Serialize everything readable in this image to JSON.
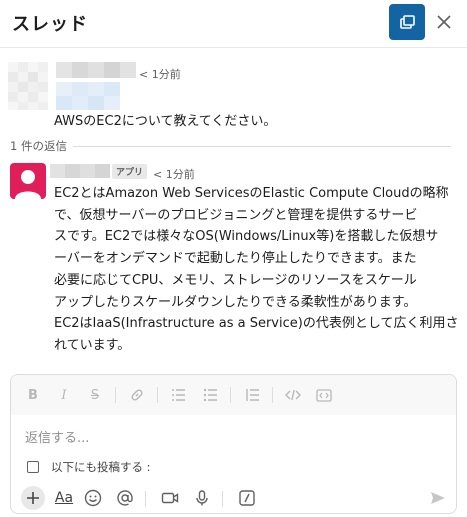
{
  "header": {
    "title": "スレッド"
  },
  "parent_message": {
    "time": "< 1分前",
    "text": "AWSのEC2について教えてください。"
  },
  "replies": {
    "count_label": "1 件の返信"
  },
  "reply": {
    "badge": "アプリ",
    "time": "< 1分前",
    "text": "EC2とはAmazon Web ServicesのElastic Compute Cloudの略称\nで、仮想サーバーのプロビジョニングと管理を提供するサービ\nスです。EC2では様々なOS(Windows/Linux等)を搭載した仮想サ\nーバーをオンデマンドで起動したり停止したりできます。また\n必要に応じてCPU、メモリ、ストレージのリソースをスケール\nアップしたりスケールダウンしたりできる柔軟性があります。\nEC2はIaaS(Infrastructure as a Service)の代表例として広く利用さ\nれています。"
  },
  "composer": {
    "placeholder": "返信する...",
    "also_send_label": "以下にも投稿する :",
    "format_bold": "B",
    "format_italic": "I",
    "format_strike": "S",
    "text_style": "Aa"
  }
}
